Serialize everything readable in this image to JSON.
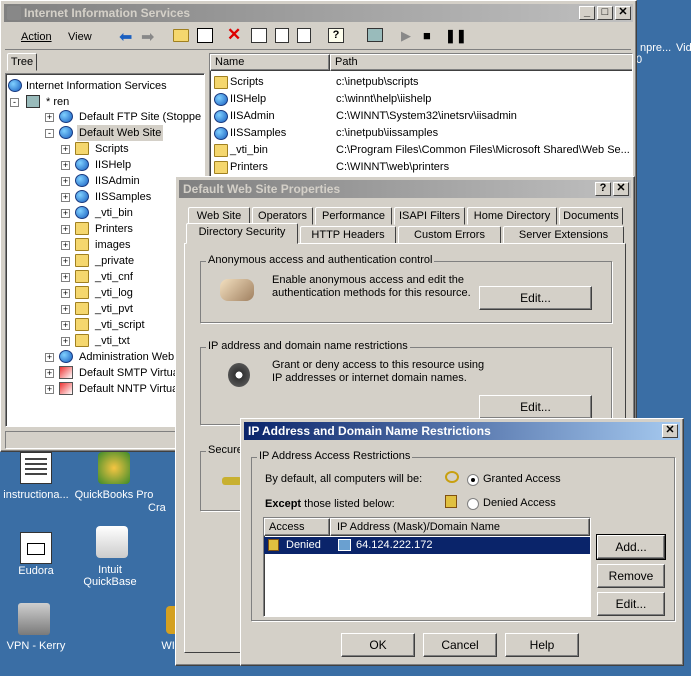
{
  "iis_window": {
    "title": "Internet Information Services",
    "menu": [
      "Action",
      "View"
    ],
    "tree_tab": "Tree",
    "tree": [
      {
        "label": "Internet Information Services"
      },
      {
        "label": "* ren"
      },
      {
        "label": "Default FTP Site (Stopped)"
      },
      {
        "label": "Default Web Site"
      },
      {
        "label": "Scripts"
      },
      {
        "label": "IISHelp"
      },
      {
        "label": "IISAdmin"
      },
      {
        "label": "IISSamples"
      },
      {
        "label": "_vti_bin"
      },
      {
        "label": "Printers"
      },
      {
        "label": "images"
      },
      {
        "label": "_private"
      },
      {
        "label": "_vti_cnf"
      },
      {
        "label": "_vti_log"
      },
      {
        "label": "_vti_pvt"
      },
      {
        "label": "_vti_script"
      },
      {
        "label": "_vti_txt"
      },
      {
        "label": "Administration Web Site"
      },
      {
        "label": "Default SMTP Virtual Se"
      },
      {
        "label": "Default NNTP Virtual Se"
      }
    ],
    "list_headers": [
      "Name",
      "Path"
    ],
    "list_rows": [
      {
        "name": "Scripts",
        "path": "c:\\inetpub\\scripts"
      },
      {
        "name": "IISHelp",
        "path": "c:\\winnt\\help\\iishelp"
      },
      {
        "name": "IISAdmin",
        "path": "C:\\WINNT\\System32\\inetsrv\\iisadmin"
      },
      {
        "name": "IISSamples",
        "path": "c:\\inetpub\\iissamples"
      },
      {
        "name": "_vti_bin",
        "path": "C:\\Program Files\\Common Files\\Microsoft Shared\\Web Se..."
      },
      {
        "name": "Printers",
        "path": "C:\\WINNT\\web\\printers"
      }
    ]
  },
  "props_dialog": {
    "title": "Default Web Site Properties",
    "tabs_row1": [
      "Web Site",
      "Operators",
      "Performance",
      "ISAPI Filters",
      "Home Directory",
      "Documents"
    ],
    "tabs_row2": [
      "Directory Security",
      "HTTP Headers",
      "Custom Errors",
      "Server Extensions"
    ],
    "anon_group": "Anonymous access and authentication control",
    "anon_text": "Enable anonymous access and edit the authentication methods for this resource.",
    "ip_group": "IP address and domain name restrictions",
    "ip_text": "Grant or deny access to this resource using IP addresses or internet domain names.",
    "secure_group": "Secure",
    "edit": "Edit..."
  },
  "ip_dialog": {
    "title": "IP Address and Domain Name Restrictions",
    "group": "IP Address Access Restrictions",
    "default_text": "By default, all computers will be:",
    "granted": "Granted Access",
    "denied": "Denied Access",
    "except_bold": "Except",
    "except_rest": "those listed below:",
    "col_access": "Access",
    "col_ip": "IP Address (Mask)/Domain Name",
    "row_access": "Denied",
    "row_ip": "64.124.222.172",
    "add": "Add...",
    "remove": "Remove",
    "edit": "Edit...",
    "ok": "OK",
    "cancel": "Cancel",
    "help": "Help"
  },
  "desktop": {
    "icons": [
      "instructiona...",
      "QuickBooks Pro",
      "Eudora",
      "Intuit QuickBase",
      "VPN - Kerry",
      "WINAMP",
      "Cra"
    ],
    "right_text": [
      "npre...",
      "Vid",
      "0"
    ]
  },
  "colors": {
    "desktop": "#3a6ea5",
    "title_active": "#0a246a",
    "selection": "#0a246a",
    "face": "#d4d0c8"
  }
}
